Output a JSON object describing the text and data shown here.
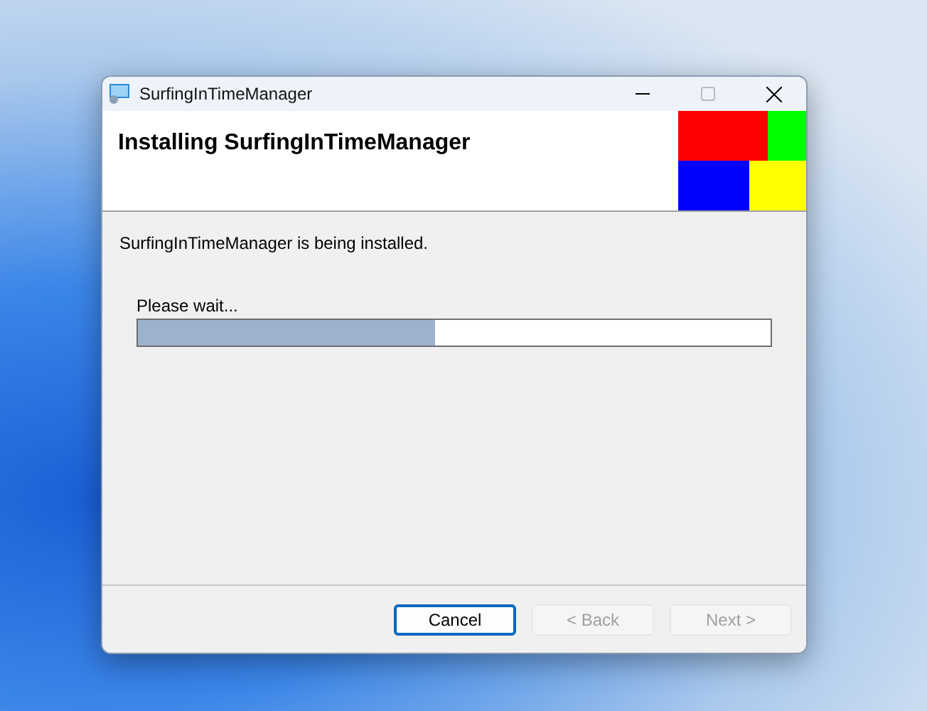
{
  "window": {
    "title": "SurfingInTimeManager"
  },
  "banner": {
    "title": "Installing SurfingInTimeManager"
  },
  "status": "SurfingInTimeManager is being installed.",
  "progress": {
    "label": "Please wait...",
    "level": 0.47
  },
  "buttons": [
    {
      "label": "Cancel",
      "disabled": false,
      "focused": true
    },
    {
      "label": "< Back",
      "disabled": true,
      "focused": false
    },
    {
      "label": "Next >",
      "disabled": true,
      "focused": false
    }
  ]
}
